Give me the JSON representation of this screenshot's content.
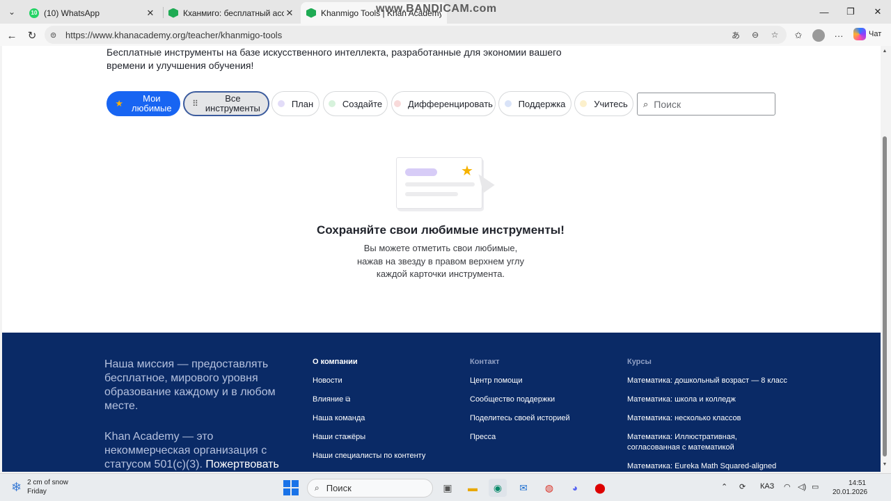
{
  "browser": {
    "tabs": [
      {
        "title": "(10) WhatsApp",
        "badge": "10",
        "favicon": "whatsapp-icon",
        "active": false
      },
      {
        "title": "Кханмиго: бесплатный ассистент",
        "favicon": "khanmigo-icon",
        "active": false
      },
      {
        "title": "Khanmigo Tools | Khan Academy",
        "favicon": "khanmigo-icon",
        "active": true
      }
    ],
    "watermark": "www.BANDICAM.com",
    "url": "https://www.khanacademy.org/teacher/khanmigo-tools",
    "copilot_label": "Чат"
  },
  "page": {
    "subtitle": "Бесплатные инструменты на базе искусственного интеллекта, разработанные для экономии вашего времени и улучшения обучения!",
    "filters": {
      "favorites_line1": "Мои",
      "favorites_line2": "любимые",
      "all_line1": "Все",
      "all_line2": "инструменты",
      "plan": "План",
      "create": "Создайте",
      "differentiate": "Дифференцировать",
      "support": "Поддержка",
      "learn": "Учитесь",
      "colors": {
        "plan": "#e2dcf8",
        "create": "#d7f2dc",
        "differentiate": "#f8dada",
        "support": "#d9e3f8",
        "learn": "#fcf0cc"
      }
    },
    "search": {
      "placeholder": "Поиск",
      "value": ""
    },
    "empty_state": {
      "title": "Сохраняйте свои любимые инструменты!",
      "line1": "Вы можете отметить свои любимые,",
      "line2": "нажав на звезду в правом верхнем углу",
      "line3": "каждой карточки инструмента."
    }
  },
  "footer": {
    "mission": "Наша миссия — предоставлять бесплатное, мирового уровня образование каждому и в любом месте.",
    "nonprofit": "Khan Academy — это некоммерческая организация с статусом 501(c)(3).",
    "donate": "Пожертвовать",
    "about": {
      "heading": "О компании",
      "links": [
        "Новости",
        "Влияние",
        "Наша команда",
        "Наши стажёры",
        "Наши специалисты по контенту"
      ]
    },
    "contact": {
      "heading": "Контакт",
      "links": [
        "Центр помощи",
        "Сообщество поддержки",
        "Поделитесь своей историей",
        "Пресса"
      ]
    },
    "courses": {
      "heading": "Курсы",
      "links": [
        "Математика: дошкольный возраст — 8 класс",
        "Математика: школа и колледж",
        "Математика: несколько классов",
        "Математика: Иллюстративная,",
        "согласованная с математикой",
        "Математика: Eureka Math Squared-aligned"
      ]
    }
  },
  "taskbar": {
    "weather_line1": "2 cm of snow",
    "weather_line2": "Friday",
    "search_placeholder": "Поиск",
    "lang": "КАЗ",
    "time": "14:51",
    "date": "20.01.2026"
  },
  "colors": {
    "brand_blue": "#1865f2",
    "footer_bg": "#0a2a66",
    "star": "#f6b200"
  }
}
